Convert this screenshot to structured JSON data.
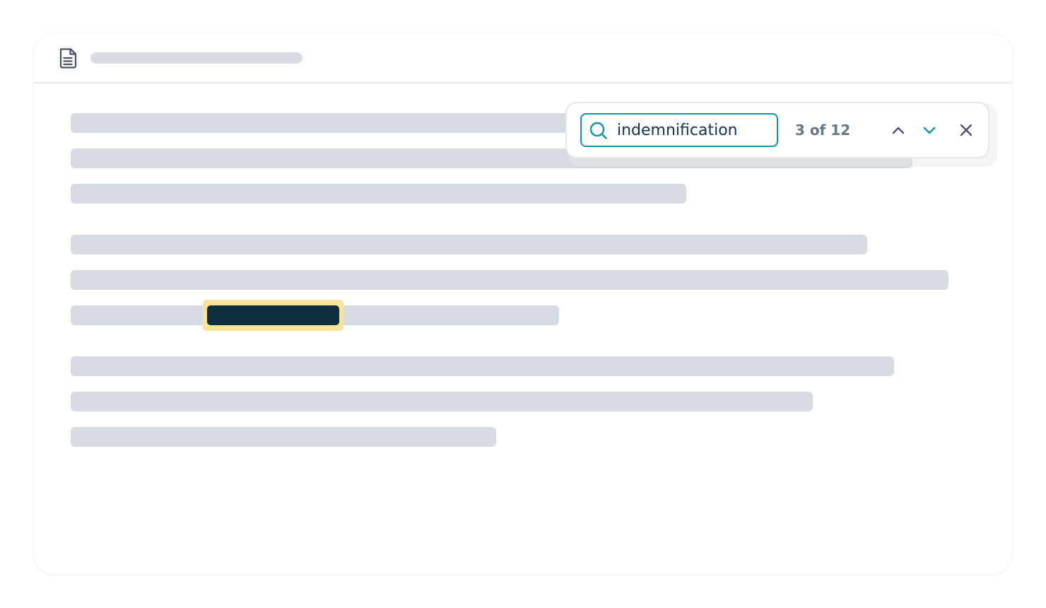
{
  "find_bar": {
    "query": "indemnification",
    "match_count": "3 of 12"
  },
  "icons": {
    "document": "document-icon",
    "search": "search-icon",
    "previous": "chevron-up-icon",
    "next": "chevron-down-icon",
    "close": "close-icon"
  },
  "colors": {
    "accent": "#1495a3",
    "highlight": "#f8e39b",
    "current_match": "#0f2f3e",
    "skeleton": "#d7dce2",
    "muted_text": "#667887"
  }
}
